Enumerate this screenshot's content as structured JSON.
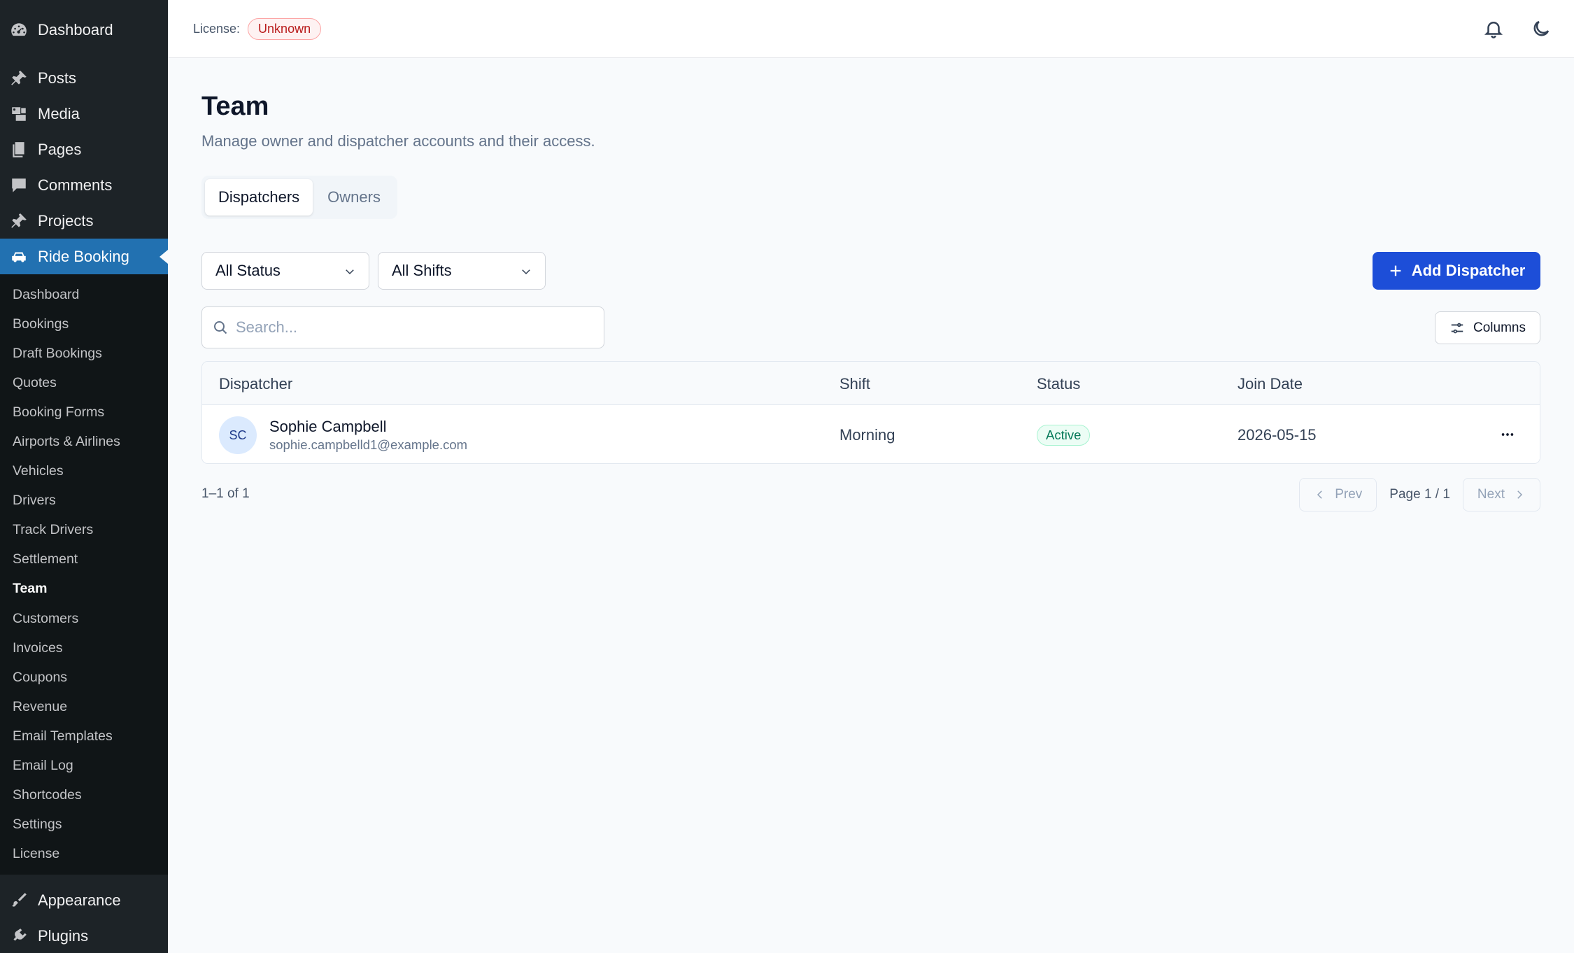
{
  "sidebar": {
    "top": {
      "label": "Dashboard",
      "icon": "dashboard-icon"
    },
    "menu": [
      {
        "label": "Posts",
        "icon": "pin-icon"
      },
      {
        "label": "Media",
        "icon": "media-icon"
      },
      {
        "label": "Pages",
        "icon": "pages-icon"
      },
      {
        "label": "Comments",
        "icon": "comment-icon"
      },
      {
        "label": "Projects",
        "icon": "pin-icon"
      },
      {
        "label": "Ride Booking",
        "icon": "car-icon"
      }
    ],
    "submenu": [
      "Dashboard",
      "Bookings",
      "Draft Bookings",
      "Quotes",
      "Booking Forms",
      "Airports & Airlines",
      "Vehicles",
      "Drivers",
      "Track Drivers",
      "Settlement",
      "Team",
      "Customers",
      "Invoices",
      "Coupons",
      "Revenue",
      "Email Templates",
      "Email Log",
      "Shortcodes",
      "Settings",
      "License"
    ],
    "current_submenu": "Team",
    "bottom": [
      {
        "label": "Appearance",
        "icon": "brush-icon"
      },
      {
        "label": "Plugins",
        "icon": "plugin-icon"
      }
    ]
  },
  "topbar": {
    "license_label": "License:",
    "license_status": "Unknown"
  },
  "page": {
    "title": "Team",
    "subtitle": "Manage owner and dispatcher accounts and their access."
  },
  "tabs": [
    {
      "label": "Dispatchers",
      "active": true
    },
    {
      "label": "Owners",
      "active": false
    }
  ],
  "filters": {
    "status": "All Status",
    "shift": "All Shifts"
  },
  "add_button": "Add Dispatcher",
  "search": {
    "placeholder": "Search...",
    "value": ""
  },
  "columns_button": "Columns",
  "table": {
    "headers": {
      "dispatcher": "Dispatcher",
      "shift": "Shift",
      "status": "Status",
      "join_date": "Join Date"
    },
    "rows": [
      {
        "initials": "SC",
        "name": "Sophie Campbell",
        "email": "sophie.campbelld1@example.com",
        "shift": "Morning",
        "status": "Active",
        "join_date": "2026-05-15"
      }
    ]
  },
  "pagination": {
    "count": "1–1 of 1",
    "prev": "Prev",
    "page": "Page 1 / 1",
    "next": "Next"
  },
  "colors": {
    "accent": "#1d4ed8",
    "sidebar_bg": "#1d2327",
    "sidebar_active": "#2271b1",
    "status_active": "#047857",
    "license_unknown": "#b91c1c"
  }
}
